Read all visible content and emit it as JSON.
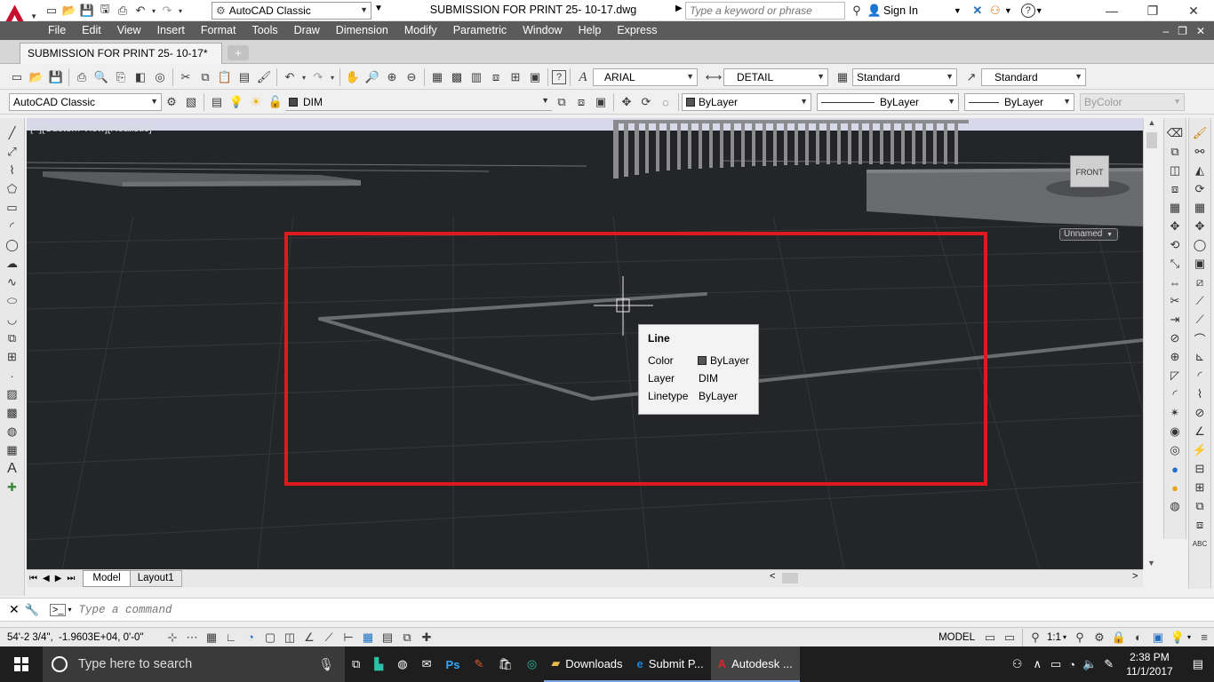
{
  "titlebar": {
    "workspace": "AutoCAD Classic",
    "document_title": "SUBMISSION FOR PRINT  25- 10-17.dwg",
    "search_placeholder": "Type a keyword or phrase",
    "sign_in": "Sign In"
  },
  "menubar": {
    "items": [
      "File",
      "Edit",
      "View",
      "Insert",
      "Format",
      "Tools",
      "Draw",
      "Dimension",
      "Modify",
      "Parametric",
      "Window",
      "Help",
      "Express"
    ]
  },
  "file_tab": {
    "label": "SUBMISSION FOR PRINT  25- 10-17*"
  },
  "toolbar1": {
    "text_style": "ARIAL",
    "dim_style": "DETAIL",
    "table_style": "Standard",
    "multileader_style": "Standard"
  },
  "toolbar2": {
    "workspace": "AutoCAD Classic",
    "layer": "DIM",
    "color": "ByLayer",
    "linetype": "ByLayer",
    "lineweight": "ByLayer",
    "plotstyle": "ByColor"
  },
  "viewport": {
    "label": "[−][Custom View][Realistic]",
    "viewcube_label": "FRONT",
    "ucs_label": "Unnamed",
    "highlight_color": "#e0191d"
  },
  "tooltip": {
    "title": "Line",
    "rows": [
      {
        "key": "Color",
        "value": "ByLayer"
      },
      {
        "key": "Layer",
        "value": "DIM"
      },
      {
        "key": "Linetype",
        "value": "ByLayer"
      }
    ]
  },
  "layout_tabs": [
    "Model",
    "Layout1"
  ],
  "command": {
    "placeholder": "Type a command"
  },
  "statusbar": {
    "coordinates": "54'-2 3/4\",  -1.9603E+04, 0'-0\"",
    "mode": "MODEL",
    "scale": "1:1"
  },
  "taskbar": {
    "search_placeholder": "Type here to search",
    "apps": [
      "Downloads",
      "Submit P...",
      "Autodesk ..."
    ],
    "time": "2:38 PM",
    "date": "11/1/2017"
  }
}
